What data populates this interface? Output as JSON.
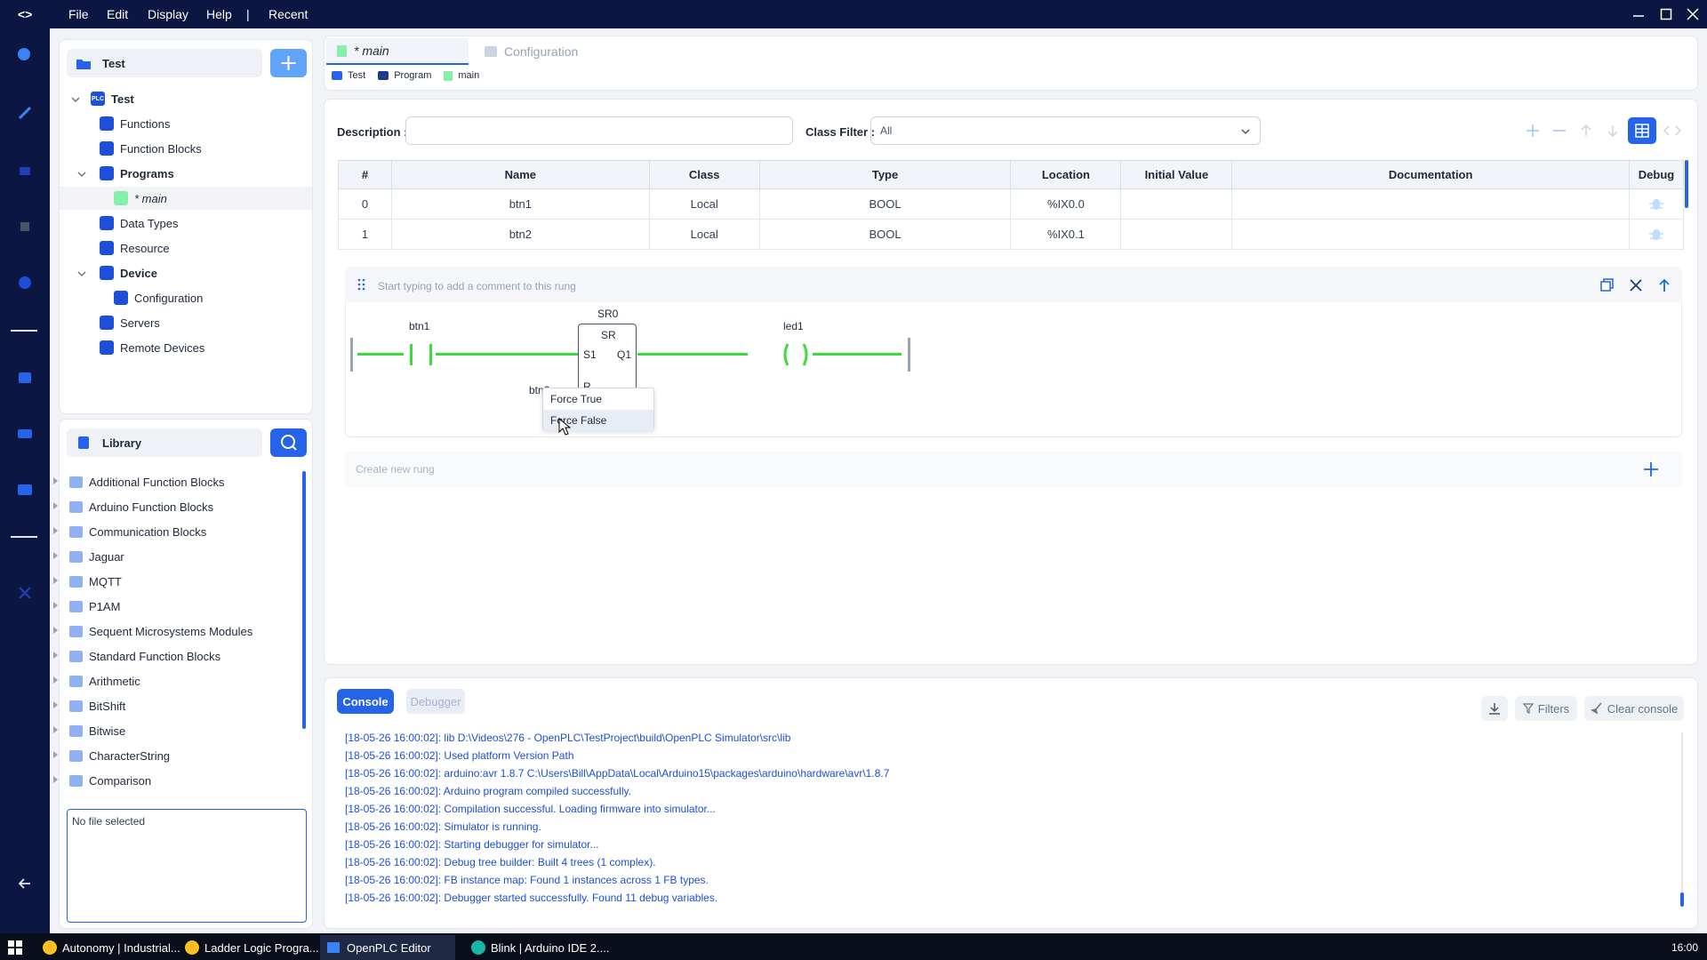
{
  "menu": {
    "file": "File",
    "edit": "Edit",
    "display": "Display",
    "help": "Help",
    "separator": "|",
    "recent": "Recent"
  },
  "project": {
    "title": "Test"
  },
  "tree": {
    "root": "Test",
    "functions": "Functions",
    "function_blocks": "Function Blocks",
    "programs": "Programs",
    "main": "* main",
    "data_types": "Data Types",
    "resource": "Resource",
    "device": "Device",
    "configuration": "Configuration",
    "servers": "Servers",
    "remote_devices": "Remote Devices",
    "plc_badge": "PLC"
  },
  "library": {
    "title": "Library",
    "items": [
      "Additional Function Blocks",
      "Arduino Function Blocks",
      "Communication Blocks",
      "Jaguar",
      "MQTT",
      "P1AM",
      "Sequent Microsystems Modules",
      "Standard Function Blocks",
      "Arithmetic",
      "BitShift",
      "Bitwise",
      "CharacterString",
      "Comparison"
    ],
    "file_box": "No file selected"
  },
  "tabs": [
    {
      "label": "* main"
    },
    {
      "label": "Configuration"
    }
  ],
  "breadcrumb": [
    "Test",
    "Program",
    "main"
  ],
  "filters": {
    "description_label": "Description :",
    "description_value": "",
    "class_filter_label": "Class Filter :",
    "class_filter_value": "All"
  },
  "table": {
    "headers": [
      "#",
      "Name",
      "Class",
      "Type",
      "Location",
      "Initial Value",
      "Documentation",
      "Debug"
    ],
    "rows": [
      {
        "num": "0",
        "name": "btn1",
        "class": "Local",
        "type": "BOOL",
        "location": "%IX0.0",
        "initial": "",
        "doc": ""
      },
      {
        "num": "1",
        "name": "btn2",
        "class": "Local",
        "type": "BOOL",
        "location": "%IX0.1",
        "initial": "",
        "doc": ""
      }
    ]
  },
  "rung": {
    "comment_placeholder": "Start typing to add a comment to this rung",
    "contact1": "btn1",
    "contact2": "btn2",
    "block_instance": "SR0",
    "block_type": "SR",
    "pin_s1": "S1",
    "pin_r": "R",
    "pin_q1": "Q1",
    "coil": "led1",
    "context_menu": [
      "Force True",
      "Force False"
    ],
    "create_new": "Create new rung"
  },
  "console": {
    "tab_console": "Console",
    "tab_debugger": "Debugger",
    "filters": "Filters",
    "clear": "Clear console",
    "lines": [
      "[18-05-26 16:00:02]: lib D:\\Videos\\276 - OpenPLC\\TestProject\\build\\OpenPLC Simulator\\src\\lib",
      "[18-05-26 16:00:02]: Used platform Version Path",
      "[18-05-26 16:00:02]: arduino:avr 1.8.7 C:\\Users\\Bill\\AppData\\Local\\Arduino15\\packages\\arduino\\hardware\\avr\\1.8.7",
      "[18-05-26 16:00:02]: Arduino program compiled successfully.",
      "[18-05-26 16:00:02]: Compilation successful. Loading firmware into simulator...",
      "[18-05-26 16:00:02]: Simulator is running.",
      "[18-05-26 16:00:02]: Starting debugger for simulator...",
      "[18-05-26 16:00:02]: Debug tree builder: Built 4 trees (1 complex).",
      "[18-05-26 16:00:02]: FB instance map: Found 1 instances across 1 FB types.",
      "[18-05-26 16:00:02]: Debugger started successfully. Found 11 debug variables."
    ]
  },
  "taskbar": {
    "items": [
      "Autonomy | Industrial...",
      "Ladder Logic Progra...",
      "OpenPLC Editor",
      "Blink | Arduino IDE 2...."
    ],
    "clock": "16:00"
  },
  "colors": {
    "accent": "#2563eb",
    "titlebar": "#0b1742",
    "energized": "#3ddc3d"
  }
}
